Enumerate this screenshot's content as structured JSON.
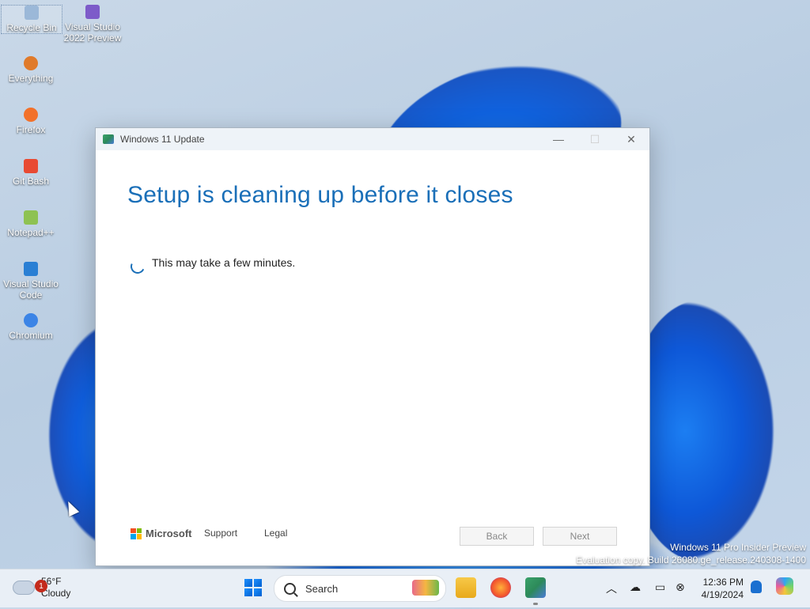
{
  "desktop": {
    "icons": [
      {
        "label": "Recycle Bin",
        "color": "#9bb8d8"
      },
      {
        "label": "Visual Studio 2022 Preview",
        "color": "#7d5bc9"
      },
      {
        "label": "Everything",
        "color": "#e07a2a"
      },
      {
        "label": "Firefox",
        "color": "#f2712a"
      },
      {
        "label": "Git Bash",
        "color": "#e84a33"
      },
      {
        "label": "Notepad++",
        "color": "#8ec253"
      },
      {
        "label": "Visual Studio Code",
        "color": "#2a7fd4"
      },
      {
        "label": "Chromium",
        "color": "#3b84e6"
      }
    ],
    "watermark": {
      "line1": "Windows 11 Pro Insider Preview",
      "line2": "Evaluation copy. Build 26080.ge_release.240308-1400"
    }
  },
  "window": {
    "title": "Windows 11 Update",
    "controls": {
      "minimize": "—",
      "maximize": "☐",
      "close": "✕"
    },
    "heading": "Setup is cleaning up before it closes",
    "message": "This may take a few minutes.",
    "footer": {
      "brand": "Microsoft",
      "support_label": "Support",
      "legal_label": "Legal",
      "back_label": "Back",
      "next_label": "Next"
    }
  },
  "taskbar": {
    "weather": {
      "temp": "56°F",
      "condition": "Cloudy",
      "badge": "1"
    },
    "search_placeholder": "Search",
    "apps": [
      "file-explorer-icon",
      "firefox-icon",
      "windows-update-icon"
    ],
    "tray_icons": [
      "chevron-up-icon",
      "onedrive-offline-icon",
      "display-icon",
      "network-icon"
    ],
    "clock": {
      "time": "12:36 PM",
      "date": "4/19/2024"
    }
  },
  "colors": {
    "accent": "#1a6fb8",
    "taskbar_bg": "#e9eff6"
  }
}
